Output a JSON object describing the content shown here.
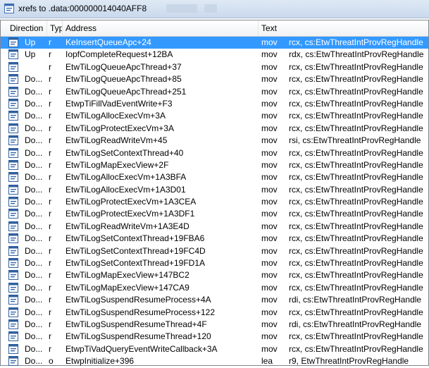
{
  "window": {
    "title": "xrefs to .data:000000014040AFF8"
  },
  "columns": [
    "Direction",
    "Typ",
    "Address",
    "Text"
  ],
  "rows": [
    {
      "direction": "Up",
      "type": "r",
      "address": "KeInsertQueueApc+24",
      "op": "mov",
      "args": "rcx, cs:EtwThreatIntProvRegHandle",
      "selected": true
    },
    {
      "direction": "Up",
      "type": "r",
      "address": "IopfCompleteRequest+12BA",
      "op": "mov",
      "args": "rdx, cs:EtwThreatIntProvRegHandle"
    },
    {
      "direction": "",
      "type": "r",
      "address": "EtwTiLogQueueApcThread+37",
      "op": "mov",
      "args": "rcx, cs:EtwThreatIntProvRegHandle"
    },
    {
      "direction": "Do...",
      "type": "r",
      "address": "EtwTiLogQueueApcThread+85",
      "op": "mov",
      "args": "rcx, cs:EtwThreatIntProvRegHandle"
    },
    {
      "direction": "Do...",
      "type": "r",
      "address": "EtwTiLogQueueApcThread+251",
      "op": "mov",
      "args": "rcx, cs:EtwThreatIntProvRegHandle"
    },
    {
      "direction": "Do...",
      "type": "r",
      "address": "EtwpTiFillVadEventWrite+F3",
      "op": "mov",
      "args": "rcx, cs:EtwThreatIntProvRegHandle"
    },
    {
      "direction": "Do...",
      "type": "r",
      "address": "EtwTiLogAllocExecVm+3A",
      "op": "mov",
      "args": "rcx, cs:EtwThreatIntProvRegHandle"
    },
    {
      "direction": "Do...",
      "type": "r",
      "address": "EtwTiLogProtectExecVm+3A",
      "op": "mov",
      "args": "rcx, cs:EtwThreatIntProvRegHandle"
    },
    {
      "direction": "Do...",
      "type": "r",
      "address": "EtwTiLogReadWriteVm+45",
      "op": "mov",
      "args": "rsi, cs:EtwThreatIntProvRegHandle"
    },
    {
      "direction": "Do...",
      "type": "r",
      "address": "EtwTiLogSetContextThread+40",
      "op": "mov",
      "args": "rcx, cs:EtwThreatIntProvRegHandle"
    },
    {
      "direction": "Do...",
      "type": "r",
      "address": "EtwTiLogMapExecView+2F",
      "op": "mov",
      "args": "rcx, cs:EtwThreatIntProvRegHandle"
    },
    {
      "direction": "Do...",
      "type": "r",
      "address": "EtwTiLogAllocExecVm+1A3BFA",
      "op": "mov",
      "args": "rcx, cs:EtwThreatIntProvRegHandle"
    },
    {
      "direction": "Do...",
      "type": "r",
      "address": "EtwTiLogAllocExecVm+1A3D01",
      "op": "mov",
      "args": "rcx, cs:EtwThreatIntProvRegHandle"
    },
    {
      "direction": "Do...",
      "type": "r",
      "address": "EtwTiLogProtectExecVm+1A3CEA",
      "op": "mov",
      "args": "rcx, cs:EtwThreatIntProvRegHandle"
    },
    {
      "direction": "Do...",
      "type": "r",
      "address": "EtwTiLogProtectExecVm+1A3DF1",
      "op": "mov",
      "args": "rcx, cs:EtwThreatIntProvRegHandle"
    },
    {
      "direction": "Do...",
      "type": "r",
      "address": "EtwTiLogReadWriteVm+1A3E4D",
      "op": "mov",
      "args": "rcx, cs:EtwThreatIntProvRegHandle"
    },
    {
      "direction": "Do...",
      "type": "r",
      "address": "EtwTiLogSetContextThread+19FBA6",
      "op": "mov",
      "args": "rcx, cs:EtwThreatIntProvRegHandle"
    },
    {
      "direction": "Do...",
      "type": "r",
      "address": "EtwTiLogSetContextThread+19FC4D",
      "op": "mov",
      "args": "rcx, cs:EtwThreatIntProvRegHandle"
    },
    {
      "direction": "Do...",
      "type": "r",
      "address": "EtwTiLogSetContextThread+19FD1A",
      "op": "mov",
      "args": "rcx, cs:EtwThreatIntProvRegHandle"
    },
    {
      "direction": "Do...",
      "type": "r",
      "address": "EtwTiLogMapExecView+147BC2",
      "op": "mov",
      "args": "rcx, cs:EtwThreatIntProvRegHandle"
    },
    {
      "direction": "Do...",
      "type": "r",
      "address": "EtwTiLogMapExecView+147CA9",
      "op": "mov",
      "args": "rcx, cs:EtwThreatIntProvRegHandle"
    },
    {
      "direction": "Do...",
      "type": "r",
      "address": "EtwTiLogSuspendResumeProcess+4A",
      "op": "mov",
      "args": "rdi, cs:EtwThreatIntProvRegHandle"
    },
    {
      "direction": "Do...",
      "type": "r",
      "address": "EtwTiLogSuspendResumeProcess+122",
      "op": "mov",
      "args": "rcx, cs:EtwThreatIntProvRegHandle"
    },
    {
      "direction": "Do...",
      "type": "r",
      "address": "EtwTiLogSuspendResumeThread+4F",
      "op": "mov",
      "args": "rdi, cs:EtwThreatIntProvRegHandle"
    },
    {
      "direction": "Do...",
      "type": "r",
      "address": "EtwTiLogSuspendResumeThread+120",
      "op": "mov",
      "args": "rcx, cs:EtwThreatIntProvRegHandle"
    },
    {
      "direction": "Do...",
      "type": "r",
      "address": "EtwpTiVadQueryEventWriteCallback+3A",
      "op": "mov",
      "args": "rcx, cs:EtwThreatIntProvRegHandle"
    },
    {
      "direction": "Do...",
      "type": "o",
      "address": "EtwpInitialize+396",
      "op": "lea",
      "args": "r9, EtwThreatIntProvRegHandle"
    }
  ],
  "colors": {
    "selection": "#3399ff",
    "header_bg": "#f1f2f4",
    "titlebar_bg": "#c9d9ec"
  },
  "icons": {
    "window": "xrefs-window-icon",
    "row": "xref-row-icon"
  }
}
